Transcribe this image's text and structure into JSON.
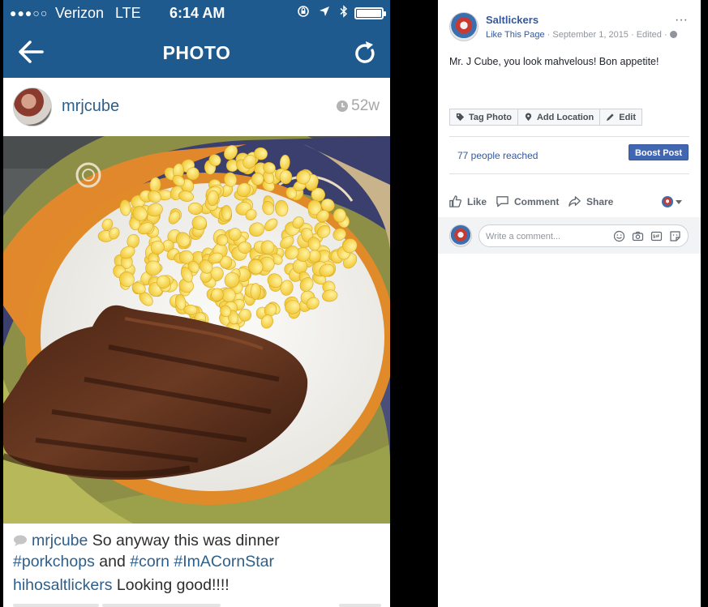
{
  "phone": {
    "status_bar": {
      "signal": "●●●○○",
      "carrier": "Verizon",
      "network": "LTE",
      "time": "6:14 AM"
    },
    "nav": {
      "title": "PHOTO"
    },
    "post": {
      "username": "mrjcube",
      "age": "52w",
      "caption": {
        "username": "mrjcube",
        "text": "So anyway this was dinner",
        "hashtags": [
          "#porkchops",
          "and",
          "#corn",
          "#ImACornStar"
        ]
      },
      "comment": {
        "username": "hihosaltlickers",
        "text": "Looking good!!!!"
      }
    },
    "colors": {
      "nav_blue": "#1f5a8e",
      "link_blue": "#2e5f8a"
    }
  },
  "facebook": {
    "page_name": "Saltlickers",
    "like_page": "Like This Page",
    "meta": "· September 1, 2015 · Edited ·",
    "post_text": "Mr. J Cube, you look mahvelous! Bon appetite!",
    "photo_actions": [
      {
        "label": "Tag Photo",
        "icon": "tag-icon"
      },
      {
        "label": "Add Location",
        "icon": "location-pin-icon"
      },
      {
        "label": "Edit",
        "icon": "pencil-icon"
      }
    ],
    "reach": "77 people reached",
    "boost_label": "Boost Post",
    "reactions": {
      "like": "Like",
      "comment": "Comment",
      "share": "Share"
    },
    "comment_placeholder": "Write a comment...",
    "colors": {
      "link": "#365899",
      "boost": "#4267b2"
    }
  }
}
